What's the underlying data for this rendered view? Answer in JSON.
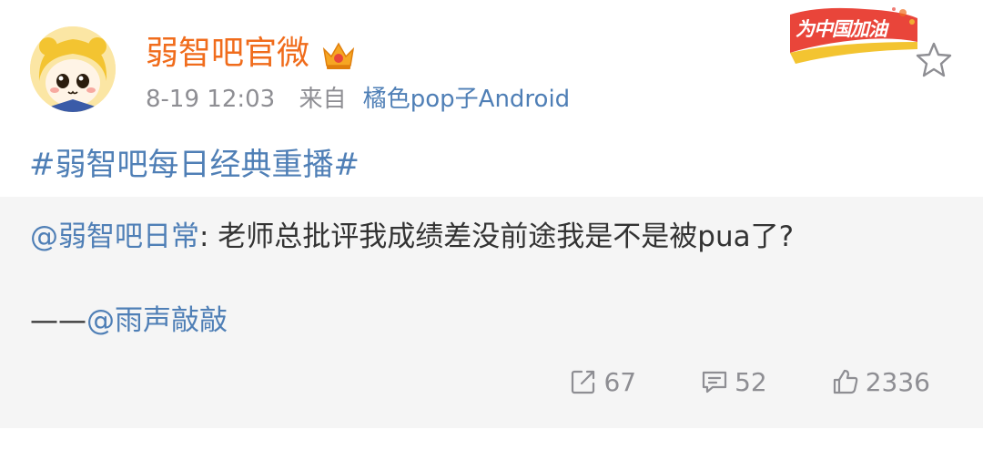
{
  "post": {
    "username": "弱智吧官微",
    "time": "8-19 12:03",
    "source_prefix": "来自",
    "source_name": "橘色pop子Android",
    "badge_text": "为中国加油",
    "hashtag": "#弱智吧每日经典重播#",
    "repost": {
      "mention": "@弱智吧日常",
      "text": ": 老师总批评我成绩差没前途我是不是被pua了?",
      "signature_prefix": "——",
      "signature_mention": "@雨声敲敲"
    },
    "actions": {
      "reposts": "67",
      "comments": "52",
      "likes": "2336"
    }
  },
  "colors": {
    "username": "#f06c1c",
    "link": "#4f7fb6",
    "meta": "#8e8e93",
    "panel": "#f5f5f5"
  },
  "icons": [
    "avatar",
    "crown-icon",
    "star-icon",
    "repost-icon",
    "comment-icon",
    "like-icon"
  ]
}
